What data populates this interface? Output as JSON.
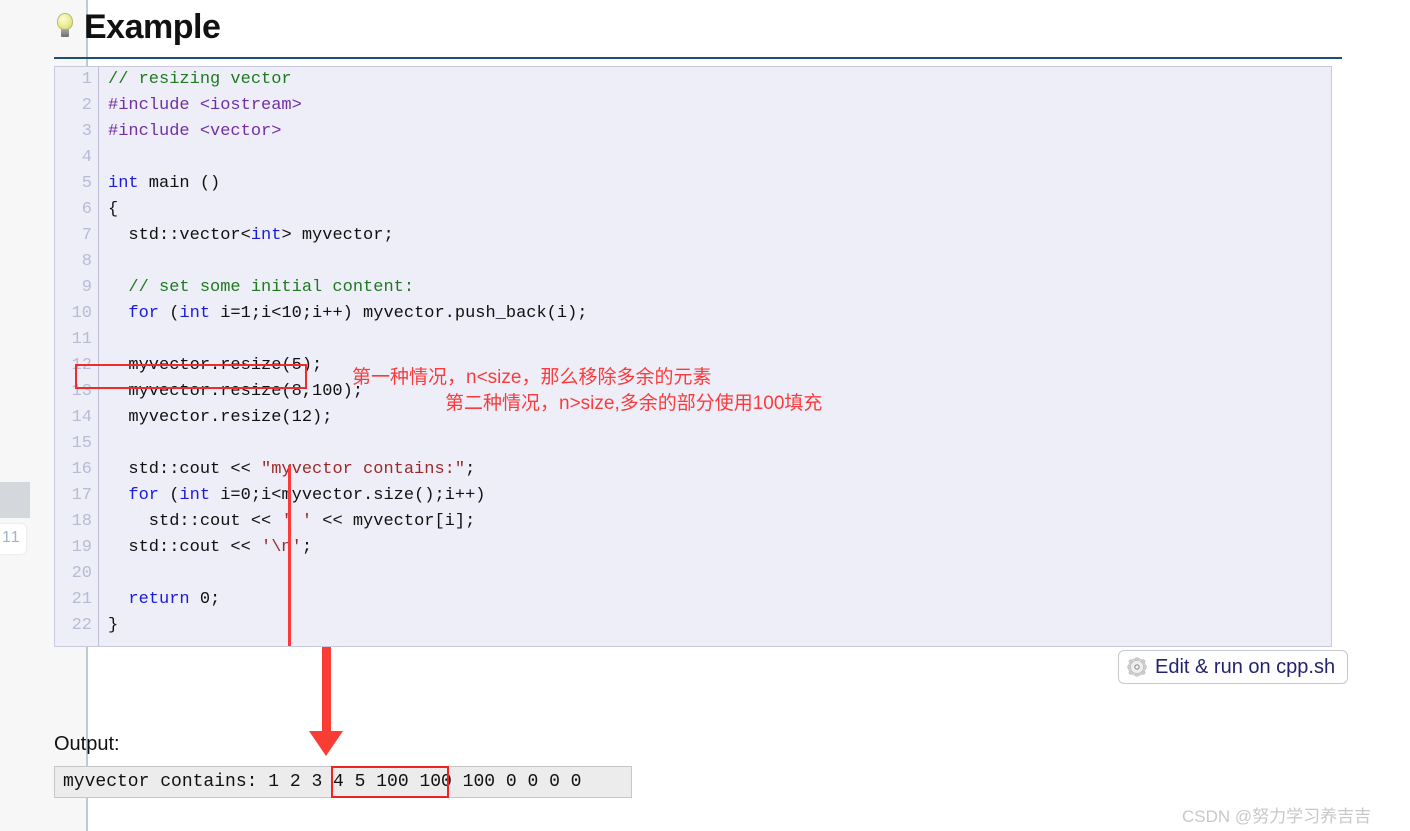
{
  "sidebar": {
    "page_number": "11"
  },
  "heading": {
    "icon": "lightbulb-icon",
    "text": "Example"
  },
  "code": {
    "line_numbers": [
      "1",
      "2",
      "3",
      "4",
      "5",
      "6",
      "7",
      "8",
      "9",
      "10",
      "11",
      "12",
      "13",
      "14",
      "15",
      "16",
      "17",
      "18",
      "19",
      "20",
      "21",
      "22"
    ],
    "lines": [
      {
        "n": 1,
        "tokens": [
          {
            "t": "// resizing vector",
            "c": "cmt"
          }
        ]
      },
      {
        "n": 2,
        "tokens": [
          {
            "t": "#include <iostream>",
            "c": "pre"
          }
        ]
      },
      {
        "n": 3,
        "tokens": [
          {
            "t": "#include <vector>",
            "c": "pre"
          }
        ]
      },
      {
        "n": 4,
        "tokens": [
          {
            "t": "",
            "c": "plain"
          }
        ]
      },
      {
        "n": 5,
        "tokens": [
          {
            "t": "int",
            "c": "kw"
          },
          {
            "t": " main ()",
            "c": "plain"
          }
        ]
      },
      {
        "n": 6,
        "tokens": [
          {
            "t": "{",
            "c": "plain"
          }
        ]
      },
      {
        "n": 7,
        "tokens": [
          {
            "t": "  std::vector<",
            "c": "plain"
          },
          {
            "t": "int",
            "c": "kw"
          },
          {
            "t": "> myvector;",
            "c": "plain"
          }
        ]
      },
      {
        "n": 8,
        "tokens": [
          {
            "t": "",
            "c": "plain"
          }
        ]
      },
      {
        "n": 9,
        "tokens": [
          {
            "t": "  // set some initial content:",
            "c": "cmt"
          }
        ]
      },
      {
        "n": 10,
        "tokens": [
          {
            "t": "  ",
            "c": "plain"
          },
          {
            "t": "for",
            "c": "kw"
          },
          {
            "t": " (",
            "c": "plain"
          },
          {
            "t": "int",
            "c": "kw"
          },
          {
            "t": " i=1;i<10;i++) myvector.push_back(i);",
            "c": "plain"
          }
        ]
      },
      {
        "n": 11,
        "tokens": [
          {
            "t": "",
            "c": "plain"
          }
        ]
      },
      {
        "n": 12,
        "tokens": [
          {
            "t": "  myvector.resize(5);",
            "c": "plain"
          }
        ]
      },
      {
        "n": 13,
        "tokens": [
          {
            "t": "  myvector.resize(8,100);",
            "c": "plain"
          }
        ]
      },
      {
        "n": 14,
        "tokens": [
          {
            "t": "  myvector.resize(12);",
            "c": "plain"
          }
        ]
      },
      {
        "n": 15,
        "tokens": [
          {
            "t": "",
            "c": "plain"
          }
        ]
      },
      {
        "n": 16,
        "tokens": [
          {
            "t": "  std::cout << ",
            "c": "plain"
          },
          {
            "t": "\"myvector contains:\"",
            "c": "str"
          },
          {
            "t": ";",
            "c": "plain"
          }
        ]
      },
      {
        "n": 17,
        "tokens": [
          {
            "t": "  ",
            "c": "plain"
          },
          {
            "t": "for",
            "c": "kw"
          },
          {
            "t": " (",
            "c": "plain"
          },
          {
            "t": "int",
            "c": "kw"
          },
          {
            "t": " i=0;i<myvector.size();i++)",
            "c": "plain"
          }
        ]
      },
      {
        "n": 18,
        "tokens": [
          {
            "t": "    std::cout << ",
            "c": "plain"
          },
          {
            "t": "' '",
            "c": "str"
          },
          {
            "t": " << myvector[i];",
            "c": "plain"
          }
        ]
      },
      {
        "n": 19,
        "tokens": [
          {
            "t": "  std::cout << ",
            "c": "plain"
          },
          {
            "t": "'\\n'",
            "c": "str"
          },
          {
            "t": ";",
            "c": "plain"
          }
        ]
      },
      {
        "n": 20,
        "tokens": [
          {
            "t": "",
            "c": "plain"
          }
        ]
      },
      {
        "n": 21,
        "tokens": [
          {
            "t": "  ",
            "c": "plain"
          },
          {
            "t": "return",
            "c": "kw"
          },
          {
            "t": " 0;",
            "c": "plain"
          }
        ]
      },
      {
        "n": 22,
        "tokens": [
          {
            "t": "}",
            "c": "plain"
          }
        ]
      }
    ]
  },
  "annotations": {
    "first_case": "第一种情况，n<size，那么移除多余的元素",
    "second_case": "第二种情况，n>size,多余的部分使用100填充",
    "color": "#fb3b3b"
  },
  "edit_run_button": {
    "icon": "gear-icon",
    "label": "Edit & run on cpp.sh"
  },
  "output": {
    "label": "Output:",
    "text": "myvector contains: 1 2 3 4 5 100 100 100 0 0 0 0",
    "highlighted_segment": "1 2 3 4 5"
  },
  "watermark": "CSDN @努力学习养吉吉",
  "colors": {
    "heading_rule": "#1f4e79",
    "code_bg": "#eeeef9",
    "comment": "#1f7a1f",
    "preprocessor": "#7030a0",
    "keyword": "#1b1bd8",
    "string": "#9a2a2a",
    "annotation_red": "#fb3b3b",
    "arrow_red": "#f93d35",
    "link_navy": "#24246e"
  }
}
